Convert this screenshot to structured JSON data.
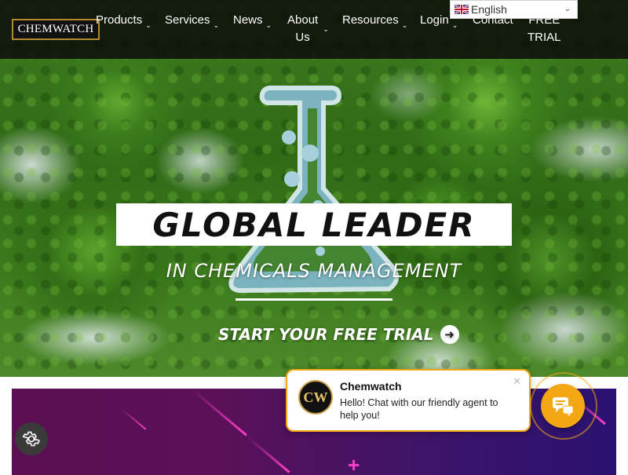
{
  "header": {
    "logo_text": "CHEMWATCH",
    "nav": {
      "products": "Products",
      "services": "Services",
      "news": "News",
      "about_line1": "About",
      "about_line2": "Us",
      "resources": "Resources",
      "login": "Login",
      "contact": "Contact",
      "trial_line1": "FREE",
      "trial_line2": "TRIAL"
    },
    "language": {
      "selected": "English",
      "flag_icon": "uk-flag-icon"
    }
  },
  "hero": {
    "headline": "GLOBAL LEADER",
    "subline": "IN CHEMICALS MANAGEMENT",
    "cta_label": "START YOUR FREE TRIAL",
    "cta_icon": "arrow-right-circle-icon"
  },
  "chat": {
    "avatar_text": "CW",
    "title": "Chemwatch",
    "message": "Hello! Chat with our friendly agent to help you!",
    "close_icon": "close-icon",
    "launcher_icon": "chat-bubbles-icon"
  },
  "widgets": {
    "settings_icon": "gear-icon"
  },
  "colors": {
    "header_bg": "#0c0e0a",
    "logo_border": "#b48a2f",
    "accent_orange": "#f3a712",
    "banner_magenta": "#5b0f52",
    "banner_purple": "#2a1270",
    "streak_pink": "#ff3fc6"
  }
}
